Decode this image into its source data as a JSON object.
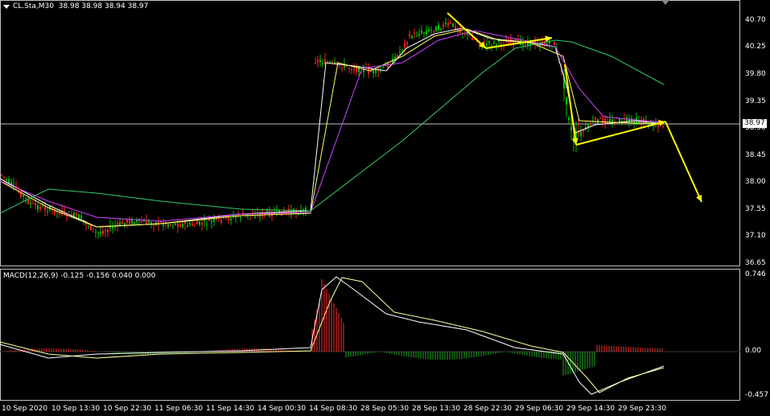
{
  "header": {
    "symbol_line": "CL.Sta,M30  38.98 38.98 38.94 38.97",
    "macd_line": "MACD(12,26,9) -0.125 -0.156 0.040 0.000"
  },
  "price_axis": {
    "ticks": [
      "40.70",
      "40.25",
      "39.80",
      "39.35",
      "38.90",
      "38.45",
      "38.00",
      "37.55",
      "37.10",
      "36.65"
    ],
    "current": "38.97"
  },
  "macd_axis": {
    "ticks": [
      "0.746",
      "0.00",
      "-0.457"
    ]
  },
  "time_axis": {
    "ticks": [
      "10 Sep 2020",
      "10 Sep 13:30",
      "10 Sep 22:30",
      "11 Sep 06:30",
      "11 Sep 14:30",
      "14 Sep 00:30",
      "14 Sep 08:30",
      "28 Sep 05:30",
      "28 Sep 13:30",
      "28 Sep 22:30",
      "29 Sep 06:30",
      "29 Sep 14:30",
      "29 Sep 23:30"
    ]
  },
  "colors": {
    "bull": "#00c000",
    "bear": "#ff2020",
    "ma_fast": "#ffffff",
    "ma_mid": "#ffff66",
    "ma_slow": "#cc44ff",
    "ma_long": "#33cc66",
    "arrow": "#ffff00",
    "macd_pos": "#ff3030",
    "macd_neg": "#22aa22",
    "signal": "#ffff99"
  }
}
